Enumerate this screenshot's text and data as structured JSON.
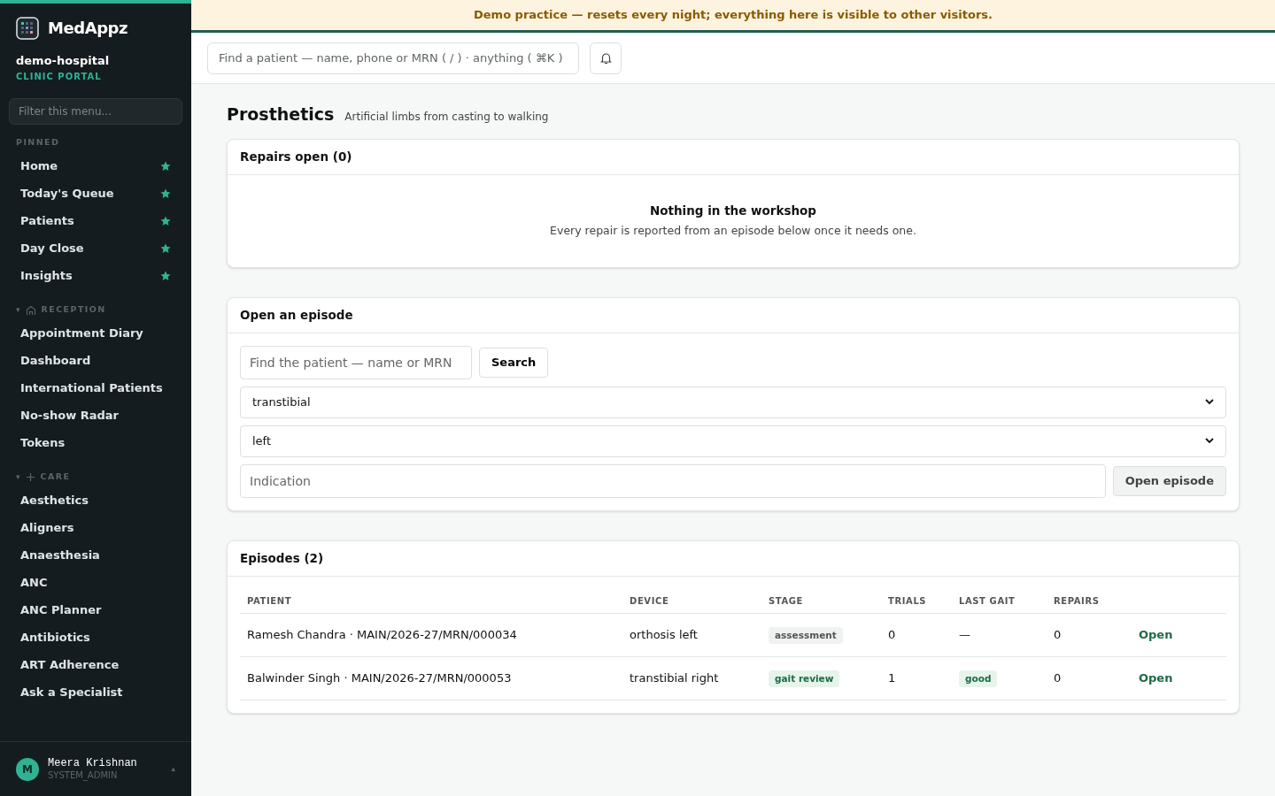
{
  "brand": {
    "name": "MedAppz",
    "org": "demo-hospital",
    "portal": "CLINIC PORTAL"
  },
  "sidebar": {
    "filter_placeholder": "Filter this menu...",
    "sections": [
      {
        "title": "PINNED",
        "kind": "pinned",
        "items": [
          {
            "label": "Home",
            "pinned": true
          },
          {
            "label": "Today's Queue",
            "pinned": true
          },
          {
            "label": "Patients",
            "pinned": true
          },
          {
            "label": "Day Close",
            "pinned": true
          },
          {
            "label": "Insights",
            "pinned": true
          }
        ]
      },
      {
        "title": "RECEPTION",
        "kind": "group",
        "caret": "▾",
        "items": [
          {
            "label": "Appointment Diary",
            "pinned": false
          },
          {
            "label": "Dashboard",
            "pinned": false
          },
          {
            "label": "International Patients",
            "pinned": false
          },
          {
            "label": "No-show Radar",
            "pinned": false
          },
          {
            "label": "Tokens",
            "pinned": false
          }
        ]
      },
      {
        "title": "CARE",
        "kind": "group",
        "caret": "▾",
        "items": [
          {
            "label": "Aesthetics",
            "pinned": false
          },
          {
            "label": "Aligners",
            "pinned": false
          },
          {
            "label": "Anaesthesia",
            "pinned": false
          },
          {
            "label": "ANC",
            "pinned": false
          },
          {
            "label": "ANC Planner",
            "pinned": false
          },
          {
            "label": "Antibiotics",
            "pinned": false
          },
          {
            "label": "ART Adherence",
            "pinned": false
          },
          {
            "label": "Ask a Specialist",
            "pinned": false
          }
        ]
      }
    ],
    "user": {
      "initial": "M",
      "menu_caret": "▴",
      "name": "Meera Krishnan",
      "role": "SYSTEM_ADMIN"
    }
  },
  "banner": "Demo practice — resets every night; everything here is visible to other visitors.",
  "topbar": {
    "search_placeholder": "Find a patient — name, phone or MRN ( / ) · anything ( ⌘K )"
  },
  "page": {
    "title": "Prosthetics",
    "subtitle": "Artificial limbs from casting to walking"
  },
  "repairs": {
    "title": "Repairs open (0)",
    "empty_title": "Nothing in the workshop",
    "empty_text": "Every repair is reported from an episode below once it needs one."
  },
  "open_episode": {
    "title": "Open an episode",
    "patient_placeholder": "Find the patient — name or MRN",
    "search_button": "Search",
    "device": "transtibial",
    "side": "left",
    "indication_placeholder": "Indication",
    "submit_button": "Open episode"
  },
  "episodes": {
    "title": "Episodes (2)",
    "columns": [
      "PATIENT",
      "DEVICE",
      "STAGE",
      "TRIALS",
      "LAST GAIT",
      "REPAIRS"
    ],
    "rows": [
      {
        "patient": "Ramesh Chandra · MAIN/2026-27/MRN/000034",
        "device": "orthosis left",
        "stage": {
          "text": "assessment",
          "kind": "neutral"
        },
        "trials": "0",
        "last_gait": {
          "text": "—",
          "kind": "plain"
        },
        "repairs": "0",
        "action": "Open"
      },
      {
        "patient": "Balwinder Singh · MAIN/2026-27/MRN/000053",
        "device": "transtibial right",
        "stage": {
          "text": "gait review",
          "kind": "success"
        },
        "trials": "1",
        "last_gait": {
          "text": "good",
          "kind": "success"
        },
        "repairs": "0",
        "action": "Open"
      }
    ]
  }
}
